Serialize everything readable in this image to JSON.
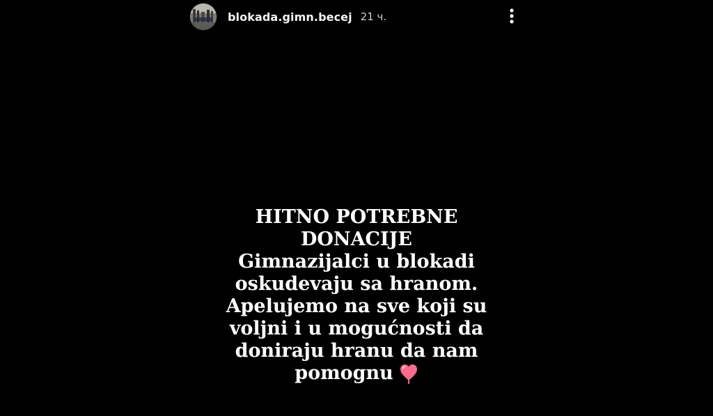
{
  "header": {
    "username": "blokada.gimn.becej",
    "time_ago": "21 ч."
  },
  "story": {
    "lines": [
      "HITNO POTREBNE",
      "DONACIJE",
      "Gimnazijalci u blokadi",
      "oskudevaju sa hranom.",
      "Apelujemo na sve koji su",
      "voljni i u mogućnosti da",
      "doniraju hranu da nam",
      "pomognu"
    ],
    "emoji": "heart-icon"
  },
  "icons": {
    "avatar": "avatar-photo",
    "menu": "more-vertical-icon"
  },
  "colors": {
    "background": "#000000",
    "text": "#ffffff",
    "secondary_text": "#cfcfcf",
    "heart": "#ff6b8c"
  }
}
